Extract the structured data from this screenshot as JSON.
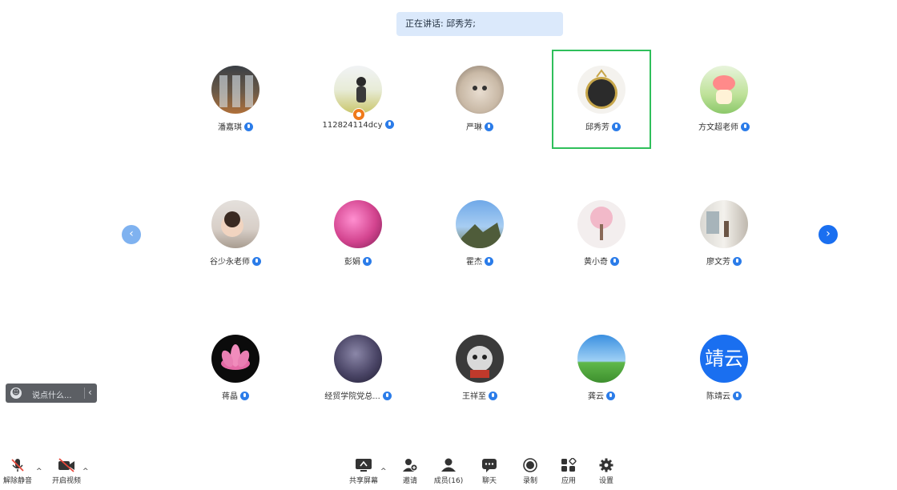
{
  "speaking": {
    "text": "正在讲话: 邱秀芳;"
  },
  "participants": [
    {
      "name": "潘嘉琪",
      "avatar": "photo-window-view"
    },
    {
      "name": "112824114dcy",
      "avatar": "photo-person-outdoor",
      "host_badge": "host-icon"
    },
    {
      "name": "严琳",
      "avatar": "photo-kitten"
    },
    {
      "name": "邱秀芳",
      "avatar": "photo-ornament",
      "active": true
    },
    {
      "name": "方文超老师",
      "avatar": "photo-cartoon"
    },
    {
      "name": "谷少永老师",
      "avatar": "photo-baby"
    },
    {
      "name": "彭娟",
      "avatar": "photo-pink-flowers"
    },
    {
      "name": "霍杰",
      "avatar": "photo-sky-tree"
    },
    {
      "name": "黄小奇",
      "avatar": "photo-cherry-blossom"
    },
    {
      "name": "廖文芳",
      "avatar": "photo-room"
    },
    {
      "name": "蒋晶",
      "avatar": "photo-lotus"
    },
    {
      "name": "经贸学院党总...",
      "avatar": "photo-starry-sky"
    },
    {
      "name": "王祥至",
      "avatar": "photo-cat-cartoon"
    },
    {
      "name": "龚云",
      "avatar": "photo-green-field"
    },
    {
      "name": "陈靖云",
      "avatar_text": "靖云"
    }
  ],
  "chat": {
    "placeholder": "说点什么...",
    "emoji_icon": "smile-icon",
    "collapse_icon": "chevron-left-icon"
  },
  "paging": {
    "prev": "‹",
    "next": "›"
  },
  "toolbar": {
    "unmute": "解除静音",
    "start_video": "开启视频",
    "share_screen": "共享屏幕",
    "invite": "邀请",
    "members": "成员(16)",
    "chat": "聊天",
    "record": "录制",
    "apps": "应用",
    "settings": "设置",
    "caret": "^"
  },
  "colors": {
    "accent": "#1a6ff0",
    "active_border": "#2fbf5b",
    "banner": "#dbe9fb",
    "muted_red": "#e8483b"
  }
}
